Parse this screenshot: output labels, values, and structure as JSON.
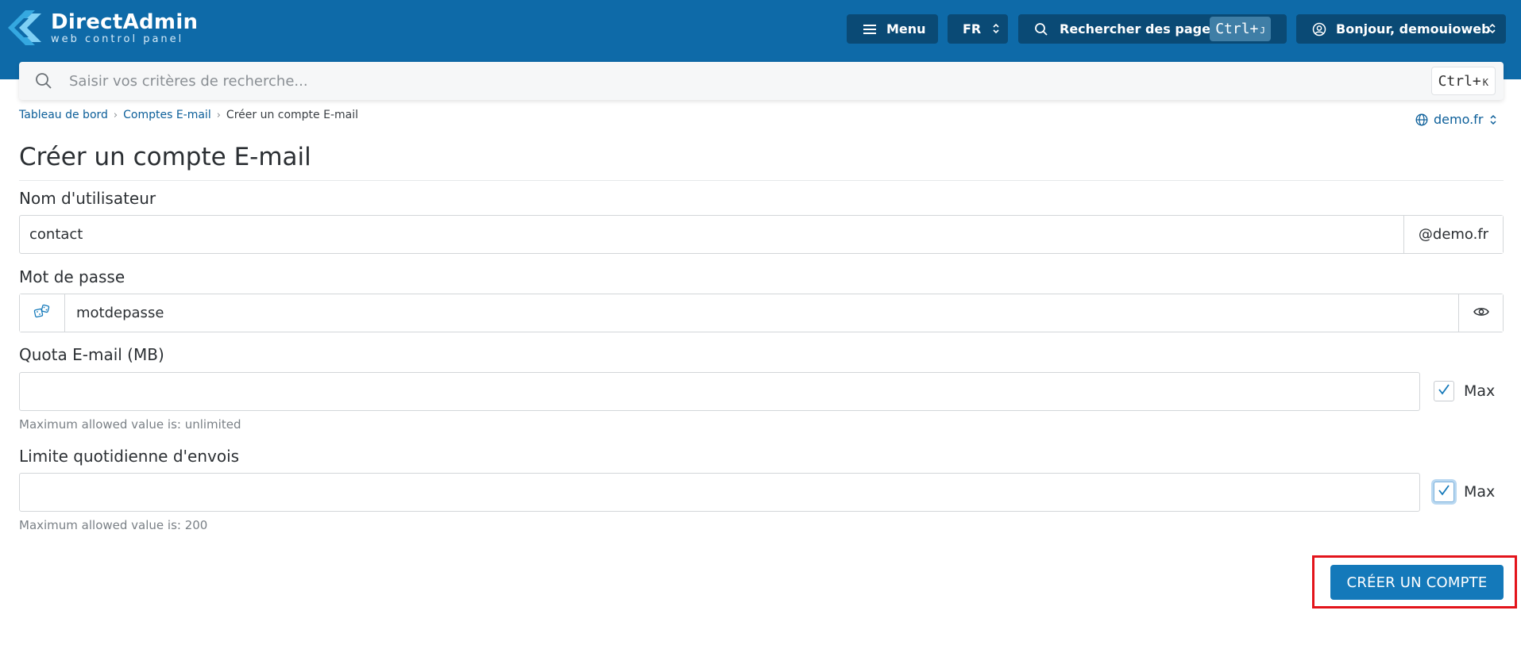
{
  "header": {
    "logo_title": "DirectAdmin",
    "logo_subtitle": "web control panel",
    "menu_label": "Menu",
    "lang_label": "FR",
    "search_label": "Rechercher des pages",
    "search_kbd": "Ctrl+",
    "search_kbd_key": "J",
    "user_label": "Bonjour, demouioweb",
    "brand_color": "#0e6aa8"
  },
  "searchbar": {
    "placeholder": "Saisir vos critères de recherche...",
    "kbd": "Ctrl+",
    "kbd_key": "K"
  },
  "breadcrumb": {
    "items": [
      "Tableau de bord",
      "Comptes E-mail"
    ],
    "current": "Créer un compte E-mail"
  },
  "domain_selector": {
    "label": "demo.fr"
  },
  "page": {
    "title": "Créer un compte E-mail"
  },
  "form": {
    "username": {
      "label": "Nom d'utilisateur",
      "value": "contact",
      "suffix": "@demo.fr"
    },
    "password": {
      "label": "Mot de passe",
      "value": "motdepasse"
    },
    "quota": {
      "label": "Quota E-mail (MB)",
      "value": "",
      "max_label": "Max",
      "max_checked": true,
      "hint": "Maximum allowed value is: unlimited"
    },
    "daily_limit": {
      "label": "Limite quotidienne d'envois",
      "value": "",
      "max_label": "Max",
      "max_checked": true,
      "hint": "Maximum allowed value is: 200"
    },
    "submit_label": "CRÉER UN COMPTE",
    "submit_color": "#1479ba"
  }
}
